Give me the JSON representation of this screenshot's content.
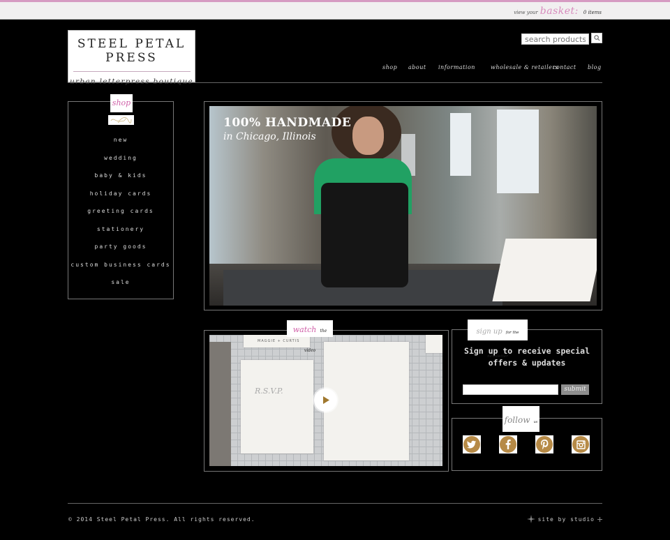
{
  "topbar": {
    "basket_prefix": "view your",
    "basket_label": "basket:",
    "basket_count": "0 items"
  },
  "logo": {
    "brand": "STEEL PETAL PRESS",
    "tagline": "urban letterpress boutique"
  },
  "search": {
    "placeholder": "search products...",
    "button_icon": "search-icon"
  },
  "nav": {
    "items": [
      {
        "label": "shop"
      },
      {
        "label": "about"
      },
      {
        "label": "information"
      },
      {
        "label": "wholesale & retailers"
      },
      {
        "label": "contact"
      },
      {
        "label": "blog"
      }
    ]
  },
  "shop": {
    "title": "shop",
    "categories": [
      {
        "label": "new"
      },
      {
        "label": "wedding"
      },
      {
        "label": "baby & kids"
      },
      {
        "label": "holiday cards"
      },
      {
        "label": "greeting cards"
      },
      {
        "label": "stationery"
      },
      {
        "label": "party goods"
      },
      {
        "label": "custom business cards"
      },
      {
        "label": "sale"
      }
    ]
  },
  "hero": {
    "title": "100% HANDMADE",
    "subtitle": "in Chicago, Illinois"
  },
  "video": {
    "tab_label": "watch",
    "tab_suffix": "the video",
    "card_label": "MAGGIE + CURTIS",
    "card_rsvp": "R.S.V.P.",
    "play_icon": "play-icon"
  },
  "newsletter": {
    "tab_label": "sign up",
    "tab_suffix": "for the newsletter",
    "text": "Sign up to receive special offers & updates",
    "input_value": "",
    "submit_label": "submit"
  },
  "follow": {
    "tab_label": "follow",
    "tab_suffix": "us",
    "networks": [
      {
        "name": "twitter",
        "icon": "twitter-icon"
      },
      {
        "name": "facebook",
        "icon": "facebook-icon"
      },
      {
        "name": "pinterest",
        "icon": "pinterest-icon"
      },
      {
        "name": "instagram",
        "icon": "instagram-icon"
      }
    ],
    "color": "#b68a46"
  },
  "footer": {
    "copyright": "© 2014 Steel Petal Press. All rights reserved.",
    "credit": "site by studio"
  },
  "colors": {
    "accent_pink": "#d88bbd",
    "border_gray": "#777777",
    "background": "#000000"
  }
}
